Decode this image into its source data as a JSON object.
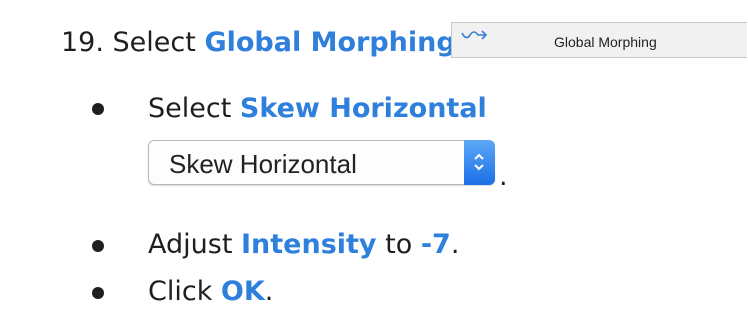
{
  "step": {
    "number": "19.",
    "prefix": "Select ",
    "target": "Global Morphing",
    "suffix": "."
  },
  "menu_snippet": {
    "icon": "morph-arrow-icon",
    "label": "Global Morphing"
  },
  "bullets": [
    {
      "prefix": "Select ",
      "target": "Skew Horizontal",
      "suffix": ""
    },
    {
      "prefix": "Adjust ",
      "target": "Intensity",
      "middle": " to ",
      "value": "-7",
      "suffix": "."
    },
    {
      "prefix": "Click ",
      "target": "OK",
      "suffix": "."
    }
  ],
  "popup": {
    "value": "Skew Horizontal",
    "icon": "stepper-chevrons-icon",
    "trailing": "."
  },
  "colors": {
    "highlight": "#2f7fdc",
    "text": "#1f1f1f",
    "stepper": "#1d6fe7"
  }
}
